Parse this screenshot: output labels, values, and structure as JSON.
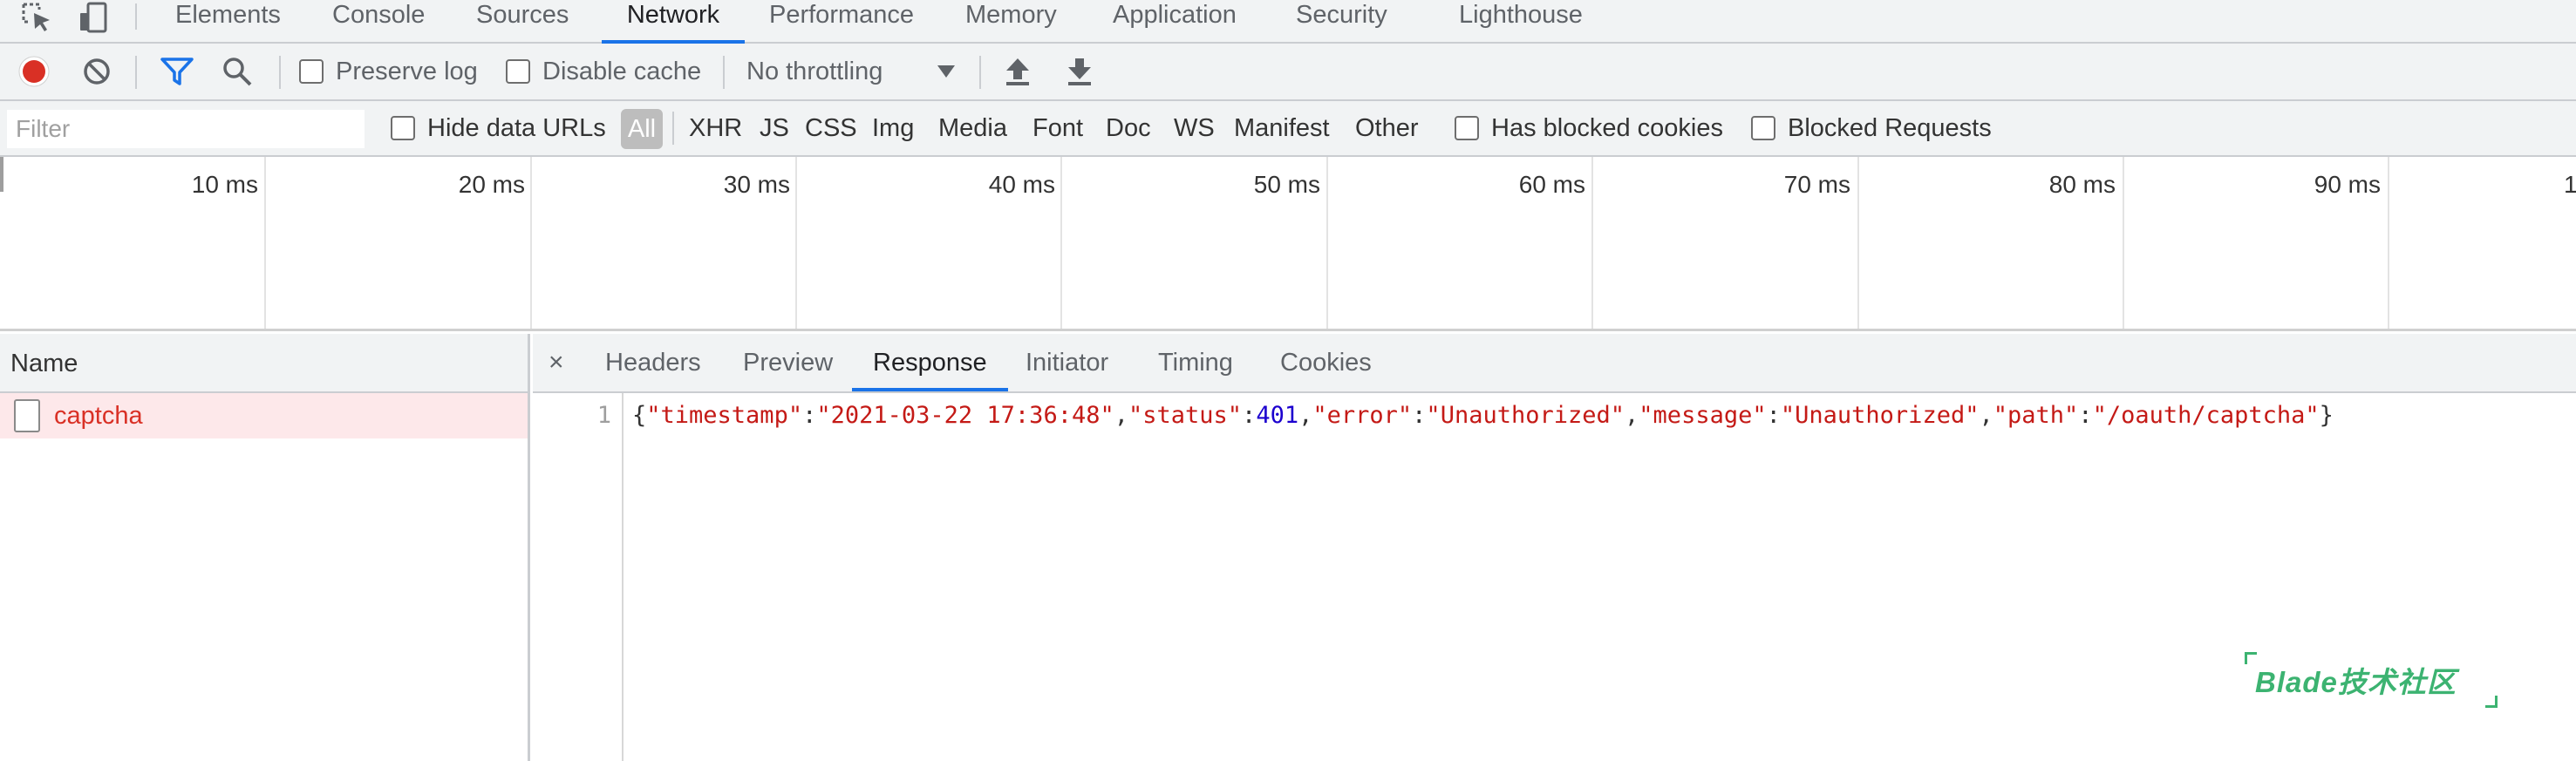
{
  "tabs": [
    {
      "label": "Elements"
    },
    {
      "label": "Console"
    },
    {
      "label": "Sources"
    },
    {
      "label": "Network"
    },
    {
      "label": "Performance"
    },
    {
      "label": "Memory"
    },
    {
      "label": "Application"
    },
    {
      "label": "Security"
    },
    {
      "label": "Lighthouse"
    }
  ],
  "active_tab": "Network",
  "toolbar": {
    "preserve_log": "Preserve log",
    "disable_cache": "Disable cache",
    "throttling": "No throttling",
    "record_color": "#d93025"
  },
  "filter": {
    "placeholder": "Filter",
    "hide_data_urls": "Hide data URLs",
    "types": [
      "All",
      "XHR",
      "JS",
      "CSS",
      "Img",
      "Media",
      "Font",
      "Doc",
      "WS",
      "Manifest",
      "Other"
    ],
    "has_blocked_cookies": "Has blocked cookies",
    "blocked_requests": "Blocked Requests"
  },
  "timeline": {
    "ticks": [
      "10 ms",
      "20 ms",
      "30 ms",
      "40 ms",
      "50 ms",
      "60 ms",
      "70 ms",
      "80 ms",
      "90 ms",
      "1"
    ]
  },
  "requests": {
    "header": "Name",
    "items": [
      {
        "name": "captcha"
      }
    ]
  },
  "detail": {
    "close": "×",
    "tabs": [
      "Headers",
      "Preview",
      "Response",
      "Initiator",
      "Timing",
      "Cookies"
    ],
    "active": "Response",
    "line_number": "1",
    "response": {
      "timestamp": "2021-03-22 17:36:48",
      "status": "401",
      "error": "Unauthorized",
      "message": "Unauthorized",
      "path": "/oauth/captcha"
    }
  },
  "watermark": "Blade技术社区"
}
